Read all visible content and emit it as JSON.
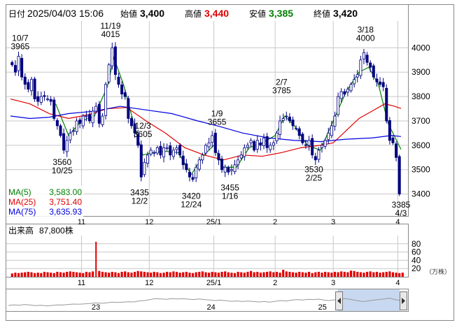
{
  "header": {
    "date_label": "日付",
    "date_value": "2025/04/03 15:06",
    "open_label": "始値",
    "open_value": "3,400",
    "high_label": "高値",
    "high_value": "3,440",
    "low_label": "安値",
    "low_value": "3,385",
    "close_label": "終値",
    "close_value": "3,420"
  },
  "colors": {
    "up": "#ffffff",
    "up_border": "#000080",
    "down": "#000080",
    "ma5": "#008000",
    "ma25": "#e00000",
    "ma75": "#0000e0",
    "high_text": "#e00000",
    "low_text": "#008000",
    "volume": "#e00000",
    "grid": "#c8c8c8"
  },
  "legend": {
    "ma5_label": "MA(5)",
    "ma5_value": "3,583.00",
    "ma25_label": "MA(25)",
    "ma25_value": "3,751.40",
    "ma75_label": "MA(75)",
    "ma75_value": "3,635.93"
  },
  "volume_label": "出来高",
  "volume_value": "87,800株",
  "volume_unit": "（万株）",
  "chart_data": [
    {
      "type": "candlestick",
      "ylim": [
        3310,
        4110
      ],
      "y_ticks": [
        3400,
        3500,
        3600,
        3700,
        3800,
        3900,
        4000
      ],
      "x_range_days": 121,
      "x_month_ticks": [
        {
          "label": "11",
          "day": 22
        },
        {
          "label": "12",
          "day": 43
        },
        {
          "label": "25/1",
          "day": 63
        },
        {
          "label": "2",
          "day": 82
        },
        {
          "label": "3",
          "day": 100
        },
        {
          "label": "4",
          "day": 120
        }
      ],
      "annotations": [
        {
          "lines": [
            "10/7",
            "3965"
          ],
          "day": 3,
          "price": 3965,
          "pos": "above"
        },
        {
          "lines": [
            "11/19",
            "4015"
          ],
          "day": 31,
          "price": 4015,
          "pos": "above"
        },
        {
          "lines": [
            "12/3",
            "3605"
          ],
          "day": 41,
          "price": 3605,
          "pos": "above"
        },
        {
          "lines": [
            "1/9",
            "3655"
          ],
          "day": 64,
          "price": 3655,
          "pos": "above"
        },
        {
          "lines": [
            "2/7",
            "3785"
          ],
          "day": 84,
          "price": 3785,
          "pos": "above"
        },
        {
          "lines": [
            "3/18",
            "4000"
          ],
          "day": 110,
          "price": 4000,
          "pos": "above"
        },
        {
          "lines": [
            "3560",
            "10/25"
          ],
          "day": 16,
          "price": 3560,
          "pos": "below"
        },
        {
          "lines": [
            "3435",
            "12/2"
          ],
          "day": 40,
          "price": 3435,
          "pos": "below"
        },
        {
          "lines": [
            "3420",
            "12/24"
          ],
          "day": 56,
          "price": 3420,
          "pos": "below"
        },
        {
          "lines": [
            "3455",
            "1/16"
          ],
          "day": 68,
          "price": 3455,
          "pos": "below"
        },
        {
          "lines": [
            "3530",
            "2/25"
          ],
          "day": 94,
          "price": 3530,
          "pos": "below"
        },
        {
          "lines": [
            "3385",
            "4/3"
          ],
          "day": 121,
          "price": 3385,
          "pos": "below"
        }
      ],
      "closes": [
        3930,
        3900,
        3965,
        3880,
        3850,
        3830,
        3870,
        3790,
        3780,
        3800,
        3800,
        3790,
        3780,
        3710,
        3680,
        3640,
        3580,
        3620,
        3650,
        3660,
        3700,
        3690,
        3720,
        3720,
        3700,
        3740,
        3760,
        3690,
        3720,
        3850,
        3930,
        4000,
        3890,
        3850,
        3810,
        3800,
        3710,
        3680,
        3650,
        3600,
        3470,
        3530,
        3560,
        3580,
        3570,
        3590,
        3560,
        3590,
        3590,
        3560,
        3580,
        3590,
        3560,
        3520,
        3500,
        3470,
        3460,
        3510,
        3540,
        3560,
        3600,
        3610,
        3640,
        3570,
        3540,
        3500,
        3510,
        3490,
        3500,
        3520,
        3540,
        3560,
        3590,
        3600,
        3620,
        3580,
        3620,
        3600,
        3630,
        3590,
        3600,
        3610,
        3650,
        3700,
        3710,
        3720,
        3700,
        3680,
        3670,
        3640,
        3610,
        3600,
        3620,
        3560,
        3540,
        3580,
        3600,
        3620,
        3650,
        3680,
        3720,
        3800,
        3820,
        3810,
        3830,
        3850,
        3870,
        3890,
        3950,
        3980,
        3940,
        3920,
        3880,
        3860,
        3850,
        3840,
        3700,
        3620,
        3610,
        3550,
        3400
      ],
      "ma_series": [
        {
          "name": "MA(5)",
          "values": [
            [
              14,
              3770
            ],
            [
              18,
              3640
            ],
            [
              22,
              3700
            ],
            [
              26,
              3720
            ],
            [
              30,
              3840
            ],
            [
              32,
              3960
            ],
            [
              35,
              3850
            ],
            [
              38,
              3700
            ],
            [
              41,
              3560
            ],
            [
              44,
              3570
            ],
            [
              48,
              3575
            ],
            [
              52,
              3570
            ],
            [
              56,
              3480
            ],
            [
              60,
              3560
            ],
            [
              63,
              3600
            ],
            [
              66,
              3510
            ],
            [
              70,
              3510
            ],
            [
              74,
              3590
            ],
            [
              78,
              3610
            ],
            [
              82,
              3640
            ],
            [
              85,
              3720
            ],
            [
              88,
              3680
            ],
            [
              92,
              3600
            ],
            [
              96,
              3580
            ],
            [
              100,
              3700
            ],
            [
              104,
              3820
            ],
            [
              108,
              3900
            ],
            [
              111,
              3920
            ],
            [
              114,
              3850
            ],
            [
              117,
              3690
            ],
            [
              121,
              3583
            ]
          ]
        },
        {
          "name": "MA(25)",
          "values": [
            [
              0,
              3790
            ],
            [
              6,
              3770
            ],
            [
              12,
              3730
            ],
            [
              18,
              3710
            ],
            [
              24,
              3725
            ],
            [
              30,
              3750
            ],
            [
              36,
              3755
            ],
            [
              42,
              3700
            ],
            [
              48,
              3650
            ],
            [
              54,
              3590
            ],
            [
              60,
              3560
            ],
            [
              66,
              3540
            ],
            [
              72,
              3560
            ],
            [
              78,
              3555
            ],
            [
              84,
              3570
            ],
            [
              90,
              3590
            ],
            [
              96,
              3600
            ],
            [
              100,
              3610
            ],
            [
              104,
              3660
            ],
            [
              108,
              3710
            ],
            [
              112,
              3740
            ],
            [
              116,
              3770
            ],
            [
              119,
              3760
            ],
            [
              121,
              3751
            ]
          ]
        },
        {
          "name": "MA(75)",
          "values": [
            [
              0,
              3720
            ],
            [
              6,
              3710
            ],
            [
              12,
              3715
            ],
            [
              18,
              3730
            ],
            [
              26,
              3740
            ],
            [
              34,
              3760
            ],
            [
              42,
              3745
            ],
            [
              50,
              3730
            ],
            [
              58,
              3700
            ],
            [
              64,
              3680
            ],
            [
              72,
              3650
            ],
            [
              80,
              3630
            ],
            [
              88,
              3620
            ],
            [
              96,
              3615
            ],
            [
              104,
              3625
            ],
            [
              112,
              3630
            ],
            [
              118,
              3640
            ],
            [
              121,
              3636
            ]
          ]
        }
      ]
    },
    {
      "type": "bar",
      "ylim": [
        0,
        100
      ],
      "y_ticks": [
        20,
        40,
        60,
        80
      ],
      "spike_day": 26,
      "values": [
        8,
        10,
        9,
        10,
        11,
        12,
        11,
        9,
        10,
        9,
        12,
        11,
        10,
        9,
        12,
        11,
        10,
        12,
        13,
        12,
        11,
        10,
        9,
        12,
        11,
        13,
        85,
        14,
        12,
        11,
        10,
        12,
        11,
        9,
        12,
        13,
        11,
        10,
        12,
        14,
        13,
        12,
        11,
        10,
        12,
        11,
        9,
        10,
        12,
        11,
        13,
        12,
        10,
        11,
        12,
        10,
        9,
        11,
        12,
        13,
        11,
        10,
        12,
        11,
        10,
        12,
        13,
        11,
        10,
        9,
        12,
        11,
        10,
        12,
        14,
        11,
        12,
        10,
        11,
        12,
        13,
        11,
        12,
        10,
        17,
        13,
        12,
        11,
        10,
        12,
        11,
        10,
        12,
        9,
        11,
        12,
        10,
        12,
        11,
        10,
        12,
        11,
        13,
        12,
        11,
        15,
        14,
        12,
        11,
        10,
        12,
        13,
        11,
        12,
        10,
        11,
        12,
        13,
        11,
        10,
        9,
        10
      ]
    }
  ],
  "overview": {
    "year_labels": [
      {
        "label": "23",
        "pos": 0.22
      },
      {
        "label": "24",
        "pos": 0.51
      },
      {
        "label": "25",
        "pos": 0.79
      }
    ],
    "values": [
      0.25,
      0.28,
      0.26,
      0.3,
      0.27,
      0.24,
      0.26,
      0.23,
      0.25,
      0.28,
      0.27,
      0.3,
      0.32,
      0.31,
      0.33,
      0.35,
      0.38,
      0.36,
      0.38,
      0.42,
      0.4,
      0.42,
      0.44,
      0.43,
      0.48,
      0.5,
      0.55,
      0.6,
      0.58,
      0.56,
      0.6,
      0.58,
      0.6,
      0.57,
      0.55,
      0.58,
      0.55,
      0.53,
      0.5,
      0.52,
      0.49,
      0.46,
      0.48,
      0.45,
      0.47,
      0.45,
      0.43,
      0.45,
      0.42,
      0.46,
      0.5,
      0.48,
      0.52,
      0.55,
      0.53,
      0.56,
      0.55,
      0.57,
      0.52,
      0.5,
      0.54,
      0.58,
      0.6,
      0.55,
      0.5,
      0.45,
      0.48,
      0.52,
      0.55,
      0.58,
      0.62,
      0.55,
      0.5,
      0.45
    ]
  }
}
